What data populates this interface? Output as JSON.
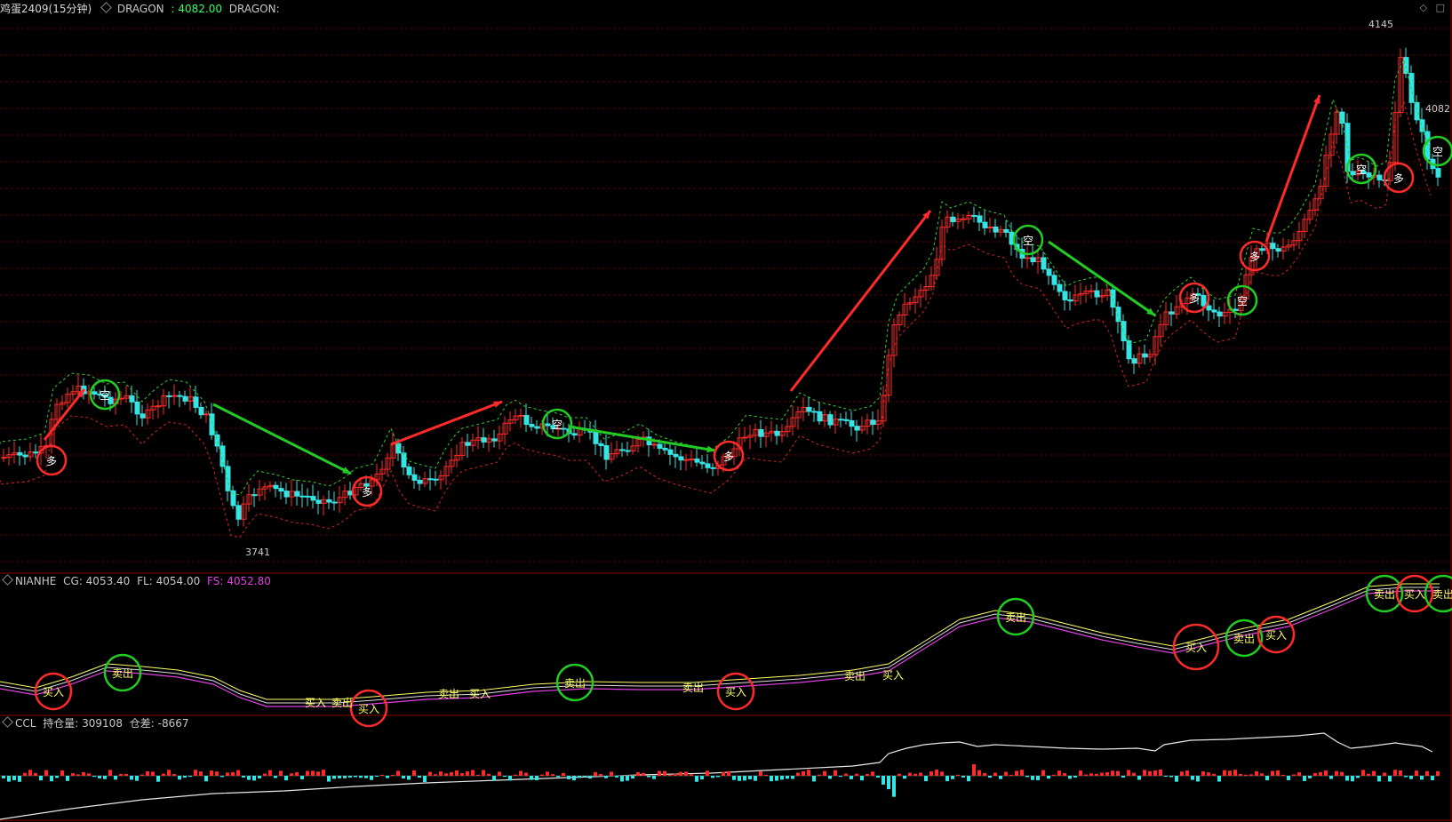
{
  "main_panel": {
    "symbol": "鸡蛋2409(15分钟)",
    "indicator_name": "DRAGON",
    "indicator_value": ": 4082.00",
    "indicator_suffix": "DRAGON:",
    "high_label": "4145",
    "low_label": "3741",
    "last_label": "4082",
    "signal_long": "多",
    "signal_short": "空"
  },
  "nianhe_panel": {
    "name": "NIANHE",
    "cg": "CG: 4053.40",
    "fl": "FL: 4054.00",
    "fs": "FS: 4052.80",
    "buy": "买入",
    "sell": "卖出"
  },
  "ccl_panel": {
    "name": "CCL",
    "oi": "持仓量: 309108",
    "diff": "仓差: -8667"
  },
  "colors": {
    "background": "#000000",
    "up": "#ff2a2a",
    "down": "#33e6e6",
    "grid": "#5a0000",
    "fs_line": "#e040e0",
    "label_yellow": "#ffff66",
    "indicator_value": "#33ff66",
    "circle_red": "#ff2a2a",
    "circle_green": "#22cc22"
  },
  "icons": {
    "collapse": "diamond-icon",
    "window": "window-icon"
  }
}
